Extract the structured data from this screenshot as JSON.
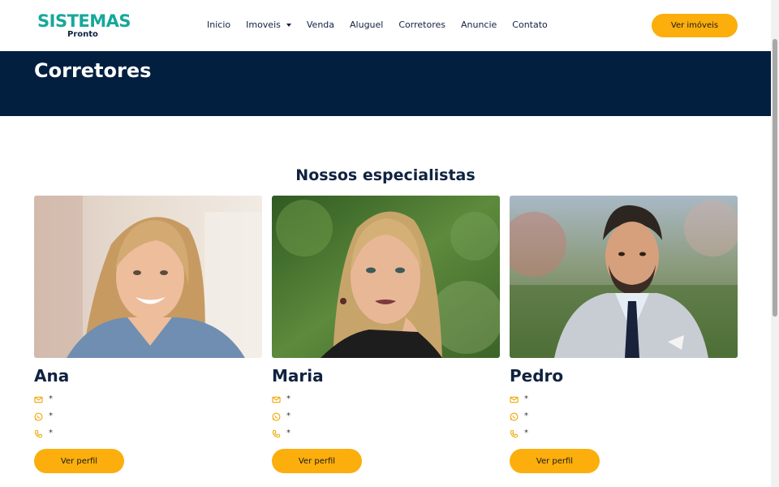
{
  "header": {
    "logo_main": "SISTEMAS",
    "logo_sub": "Pronto",
    "nav": [
      {
        "label": "Inicio"
      },
      {
        "label": "Imoveis",
        "has_dropdown": true
      },
      {
        "label": "Venda"
      },
      {
        "label": "Aluguel"
      },
      {
        "label": "Corretores"
      },
      {
        "label": "Anuncie"
      },
      {
        "label": "Contato"
      }
    ],
    "cta_label": "Ver imóveis"
  },
  "banner": {
    "title": "Corretores"
  },
  "section": {
    "title": "Nossos especialistas"
  },
  "agents": [
    {
      "name": "Ana",
      "email": "*",
      "whatsapp": "*",
      "phone": "*",
      "button": "Ver perfil"
    },
    {
      "name": "Maria",
      "email": "*",
      "whatsapp": "*",
      "phone": "*",
      "button": "Ver perfil"
    },
    {
      "name": "Pedro",
      "email": "*",
      "whatsapp": "*",
      "phone": "*",
      "button": "Ver perfil"
    }
  ],
  "icons": [
    "email-icon",
    "whatsapp-icon",
    "phone-icon",
    "chevron-down-icon"
  ],
  "colors": {
    "brand_teal": "#16a89a",
    "navy": "#031f40",
    "accent_yellow": "#fbae0c",
    "text_dark": "#0f2240"
  }
}
